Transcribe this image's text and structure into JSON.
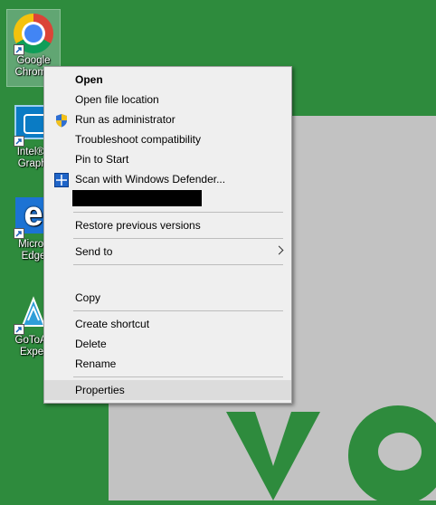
{
  "desktop": {
    "icons": [
      {
        "label_line1": "Google",
        "label_line2": "Chrome",
        "icon": "chrome-icon",
        "selected": true
      },
      {
        "label_line1": "Intel® I",
        "label_line2": "Graphi",
        "icon": "intel-graphics-icon"
      },
      {
        "label_line1": "Micros",
        "label_line2": "Edge",
        "icon": "edge-icon"
      },
      {
        "label_line1": "GoToAs",
        "label_line2": "Exper",
        "icon": "gotoassist-icon"
      }
    ]
  },
  "context_menu": {
    "items": {
      "open": "Open",
      "open_file_location": "Open file location",
      "run_as_admin": "Run as administrator",
      "troubleshoot": "Troubleshoot compatibility",
      "pin_to_start": "Pin to Start",
      "scan_defender": "Scan with Windows Defender...",
      "restore_versions": "Restore previous versions",
      "send_to": "Send to",
      "copy": "Copy",
      "create_shortcut": "Create shortcut",
      "delete": "Delete",
      "rename": "Rename",
      "properties": "Properties"
    },
    "hovered_item": "Properties",
    "icons": {
      "run_as_admin": "uac-shield-icon",
      "scan_defender": "windows-defender-icon",
      "send_to": "chevron-right-icon"
    }
  },
  "colors": {
    "wallpaper_green": "#2e8b3d",
    "wallpaper_gray": "#c2c2c2",
    "menu_background": "#efefef",
    "hover_background": "#dcdcdc"
  }
}
